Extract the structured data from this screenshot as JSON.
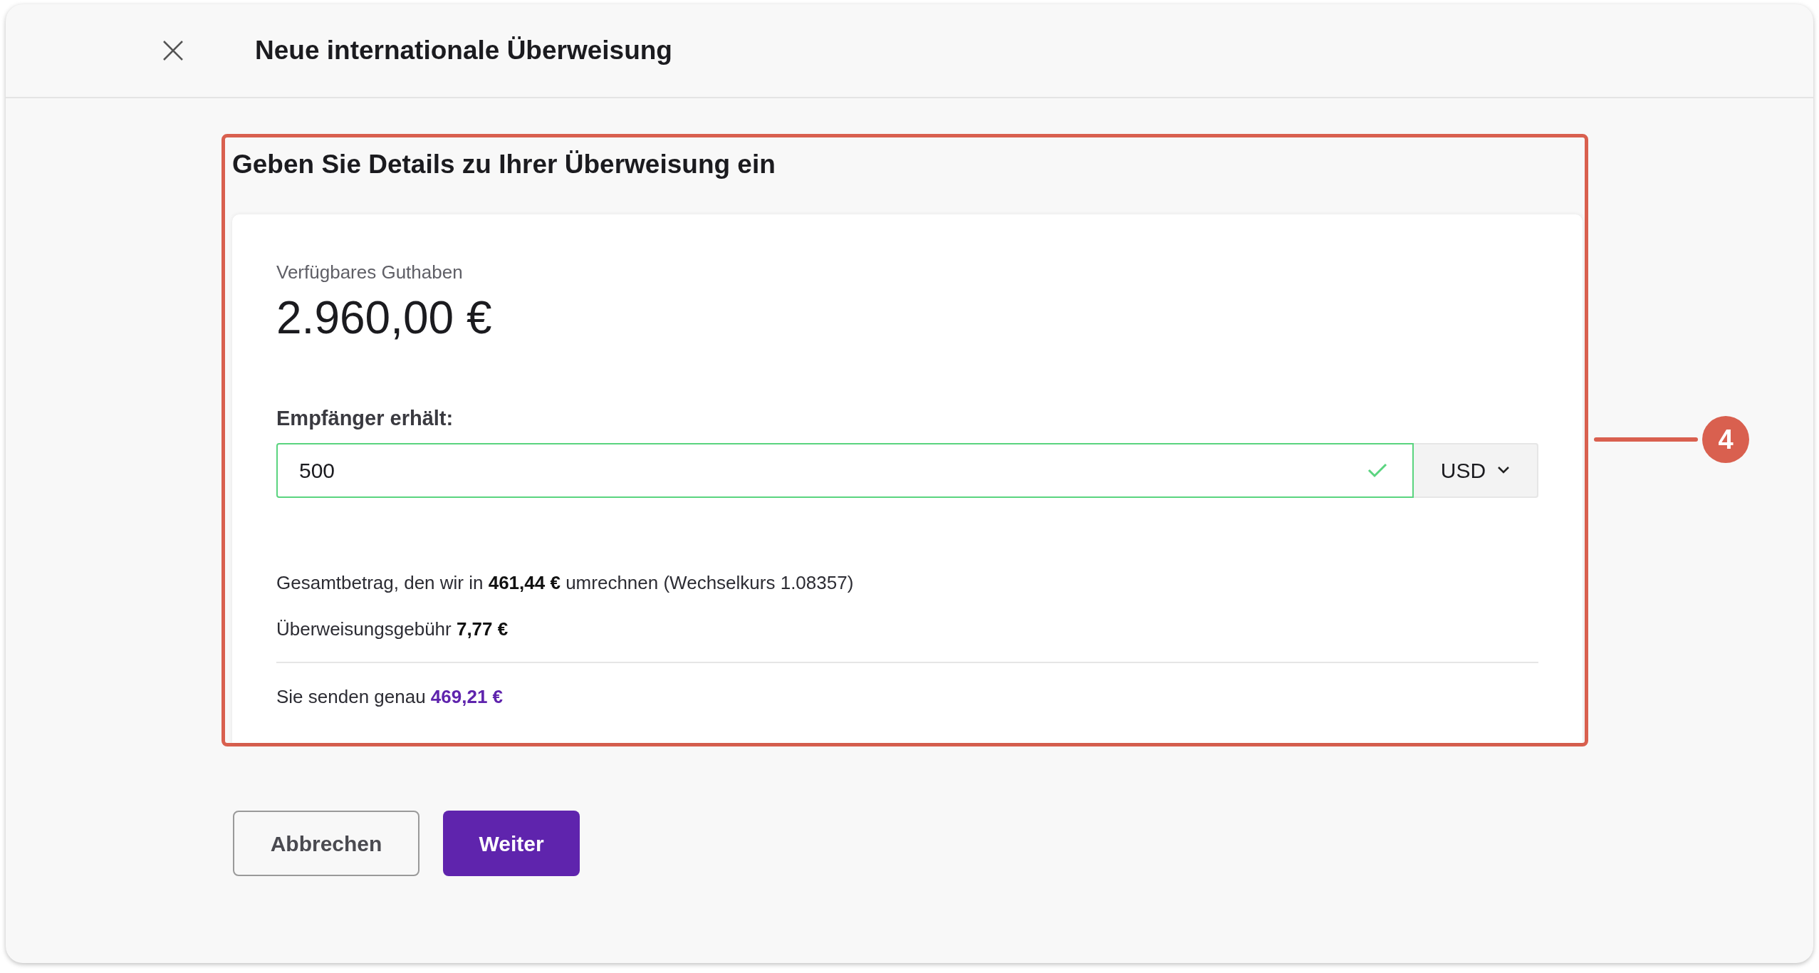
{
  "dialog": {
    "title": "Neue internationale Überweisung"
  },
  "section": {
    "heading": "Geben Sie Details zu Ihrer Überweisung ein"
  },
  "balance": {
    "label": "Verfügbares Guthaben",
    "amount": "2.960,00 €"
  },
  "amount_field": {
    "label": "Empfänger erhält:",
    "value": "500",
    "valid": true,
    "currency": "USD"
  },
  "summary": {
    "lines": [
      "Gesamtbetrag, den wir in **461,44 €** umrechnen (Wechselkurs 1.08357)",
      "Überweisungsgebühr **7,77 €**"
    ],
    "total_text": "Sie senden genau",
    "total_amount": "469,21 €"
  },
  "buttons": [
    {
      "label": "Abbrechen",
      "kind": "secondary"
    },
    {
      "label": "Weiter",
      "kind": "primary"
    }
  ],
  "callout": {
    "number": "4"
  }
}
